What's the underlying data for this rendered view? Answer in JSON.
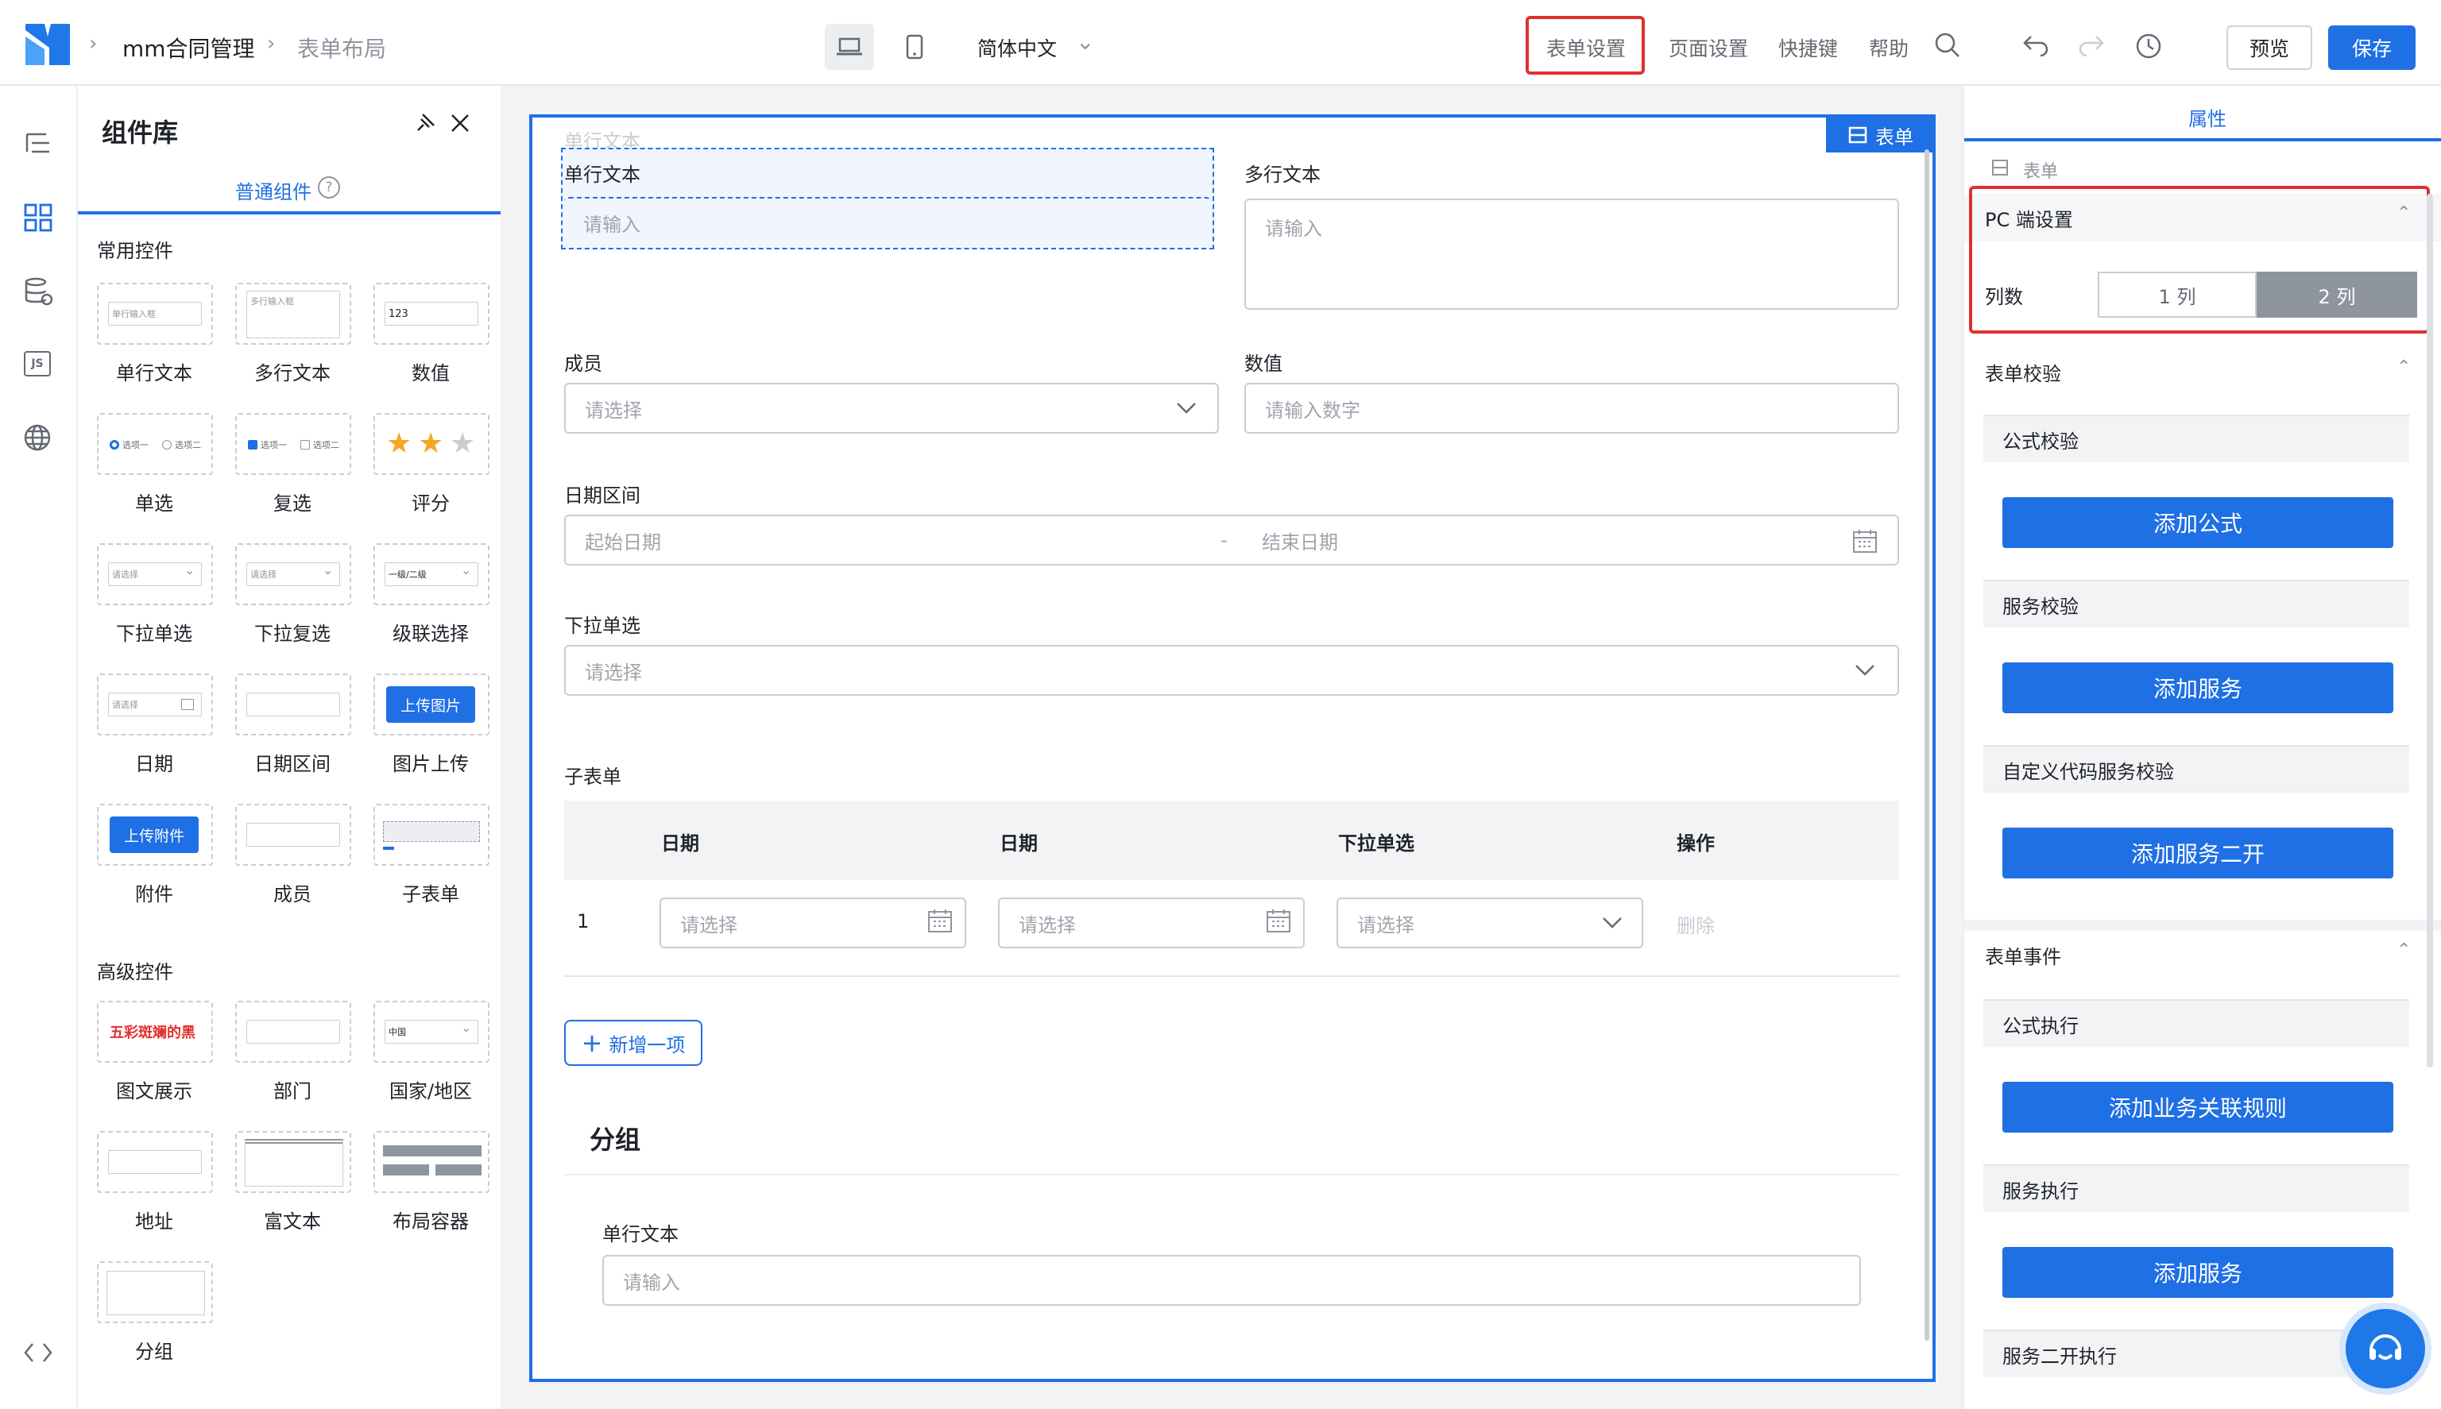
{
  "topbar": {
    "breadcrumb": [
      "mm合同管理",
      "表单布局"
    ],
    "language": "简体中文",
    "menu": [
      "表单设置",
      "页面设置",
      "快捷键",
      "帮助"
    ],
    "preview": "预览",
    "save": "保存"
  },
  "library": {
    "title": "组件库",
    "tab": "普通组件",
    "sections": [
      {
        "title": "常用控件",
        "items": [
          "单行文本",
          "多行文本",
          "数值",
          "单选",
          "复选",
          "评分",
          "下拉单选",
          "下拉复选",
          "级联选择",
          "日期",
          "日期区间",
          "图片上传",
          "附件",
          "成员",
          "子表单"
        ]
      },
      {
        "title": "高级控件",
        "items": [
          "图文展示",
          "部门",
          "国家/地区",
          "地址",
          "富文本",
          "布局容器",
          "分组"
        ]
      }
    ],
    "previews": {
      "single_text": "单行输入框",
      "multi_text": "多行输入框",
      "number": "123",
      "radio_a": "选项一",
      "radio_b": "选项二",
      "select": "请选择",
      "cascade": "一级/二级",
      "upload_image": "上传图片",
      "upload_file": "上传附件",
      "country": "中国",
      "rich_text": "五彩斑斓的黑"
    }
  },
  "canvas": {
    "ghost_label": "单行文本",
    "form_badge": "表单",
    "fields": {
      "single_text": {
        "label": "单行文本",
        "placeholder": "请输入"
      },
      "multi_text": {
        "label": "多行文本",
        "placeholder": "请输入"
      },
      "member": {
        "label": "成员",
        "placeholder": "请选择"
      },
      "number": {
        "label": "数值",
        "placeholder": "请输入数字"
      },
      "date_range": {
        "label": "日期区间",
        "start": "起始日期",
        "sep": "-",
        "end": "结束日期"
      },
      "dropdown": {
        "label": "下拉单选",
        "placeholder": "请选择"
      }
    },
    "subform": {
      "label": "子表单",
      "columns": [
        "日期",
        "日期",
        "下拉单选",
        "操作"
      ],
      "rows": [
        {
          "index": "1",
          "cells": [
            "请选择",
            "请选择",
            "请选择"
          ],
          "action": "删除"
        }
      ],
      "add": "新增一项"
    },
    "group": {
      "title": "分组",
      "field_label": "单行文本",
      "placeholder": "请输入"
    }
  },
  "props": {
    "tab": "属性",
    "crumb": "表单",
    "pc": {
      "title": "PC 端设置",
      "columns_label": "列数",
      "opt1": "1 列",
      "opt2": "2 列",
      "selected": "2 列"
    },
    "validation": {
      "title": "表单校验",
      "blocks": [
        {
          "title": "公式校验",
          "button": "添加公式"
        },
        {
          "title": "服务校验",
          "button": "添加服务"
        },
        {
          "title": "自定义代码服务校验",
          "button": "添加服务二开"
        }
      ]
    },
    "events": {
      "title": "表单事件",
      "blocks": [
        {
          "title": "公式执行",
          "button": "添加业务关联规则"
        },
        {
          "title": "服务执行",
          "button": "添加服务"
        },
        {
          "title": "服务二开执行"
        }
      ]
    }
  },
  "colors": {
    "accent": "#1f6fe5",
    "highlight": "#e0302e"
  }
}
